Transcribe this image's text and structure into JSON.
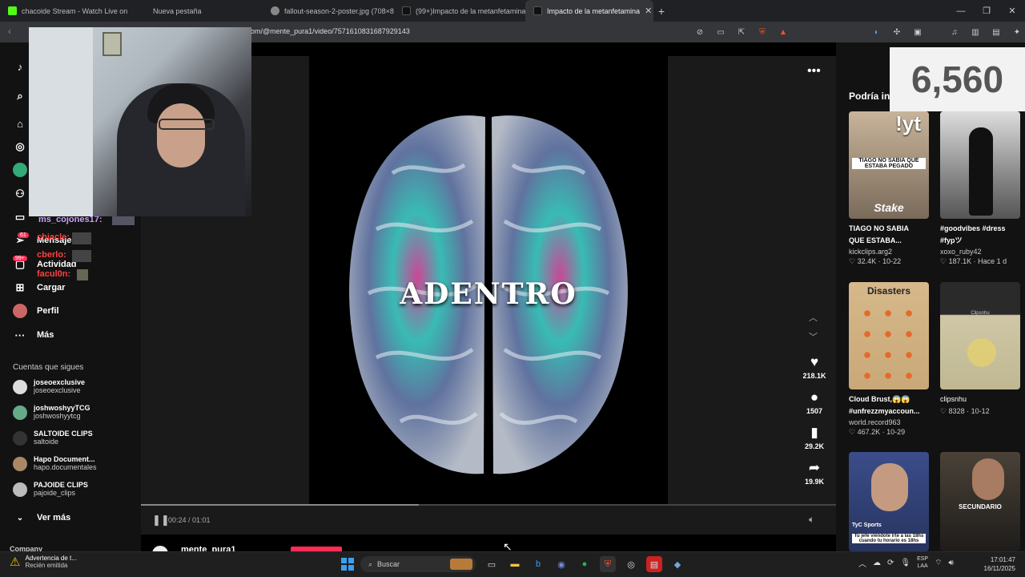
{
  "browser": {
    "tabs": [
      {
        "label": "chacoide Stream - Watch Live on",
        "color": "#53fc18"
      },
      {
        "label": "Nueva pestaña",
        "color": "#777777"
      },
      {
        "label": "fallout-season-2-poster.jpg (708×88(",
        "color": "#888888"
      },
      {
        "label": "(99+)Impacto de la metanfetamina e",
        "color": "#111111"
      },
      {
        "label": "Impacto de la metanfetamina",
        "color": "#111111"
      }
    ],
    "url": "om/@mente_pura1/video/7571610831687929143"
  },
  "nav": {
    "items": [
      {
        "label": "Mensajes",
        "badge": "61"
      },
      {
        "label": "Actividad",
        "badge": "99+"
      },
      {
        "label": "Cargar"
      },
      {
        "label": "Perfil"
      },
      {
        "label": "Más"
      }
    ],
    "following_title": "Cuentas que sigues",
    "following": [
      {
        "name": "joseoexclusive",
        "handle": "joseoexclusive"
      },
      {
        "name": "joshwoshyyTCG",
        "handle": "joshwoshyytcg"
      },
      {
        "name": "SALTOIDE CLIPS",
        "handle": "saltoide"
      },
      {
        "name": "Hapo Document...",
        "handle": "hapo.documentales"
      },
      {
        "name": "PAJOIDE CLIPS",
        "handle": "pajoide_clips"
      }
    ],
    "see_more": "Ver más",
    "company": "Company"
  },
  "stream_chat": [
    {
      "user": "ms_cojones17:",
      "color": "#c9a0ff"
    },
    {
      "user": "chiacle:",
      "color": "#ff4040"
    },
    {
      "user": "cberlo:",
      "color": "#ff4040"
    },
    {
      "user": "facul0n:",
      "color": "#ff4040"
    }
  ],
  "video": {
    "overlay_text": "ADENTRO",
    "likes": "218.1K",
    "comments": "1507",
    "saves": "29.2K",
    "shares": "19.9K",
    "time": "00:24 / 01:01",
    "progress": 0.4,
    "author": "mente_pura1"
  },
  "counter": "6,560",
  "recommended": {
    "title": "Podría in",
    "cards": [
      {
        "title": "TIAGO NO SABIA\nQUE ESTABA...",
        "user": "kickclips.arg2",
        "likes": "32.4K",
        "date": "10-22",
        "overlay": "TIAGO NO SABIA QUE ESTABA PEGADO",
        "tag": "!yt",
        "brand": "Stake"
      },
      {
        "title": "#goodvibes #dress\n#fypツ",
        "user": "xoxo_ruby42",
        "likes": "187.1K",
        "date": "Hace 1 d"
      },
      {
        "title": "Cloud Brust,😱😱\n#unfrezzmyaccoun...",
        "user": "world.record963",
        "likes": "467.2K",
        "date": "10-29",
        "overlay": "Disasters"
      },
      {
        "title": "clipsnhu",
        "user": "",
        "likes": "8328",
        "date": "10-12",
        "overlay": "Clipsnhu"
      },
      {
        "title": "",
        "user": "",
        "likes": "",
        "date": "",
        "overlay": "Tu jefe viéndote irte a las 18hs cuando tu horario es 18hs",
        "brand": "TyC Sports"
      },
      {
        "title": "",
        "user": "",
        "likes": "",
        "date": "",
        "overlay": "SECUNDARIO"
      }
    ]
  },
  "taskbar": {
    "notification_title": "Advertencia de t...",
    "notification_sub": "Recién emitida",
    "search": "Buscar",
    "lang1": "ESP",
    "lang2": "LAA",
    "time": "17:01:47",
    "date": "16/11/2025"
  }
}
